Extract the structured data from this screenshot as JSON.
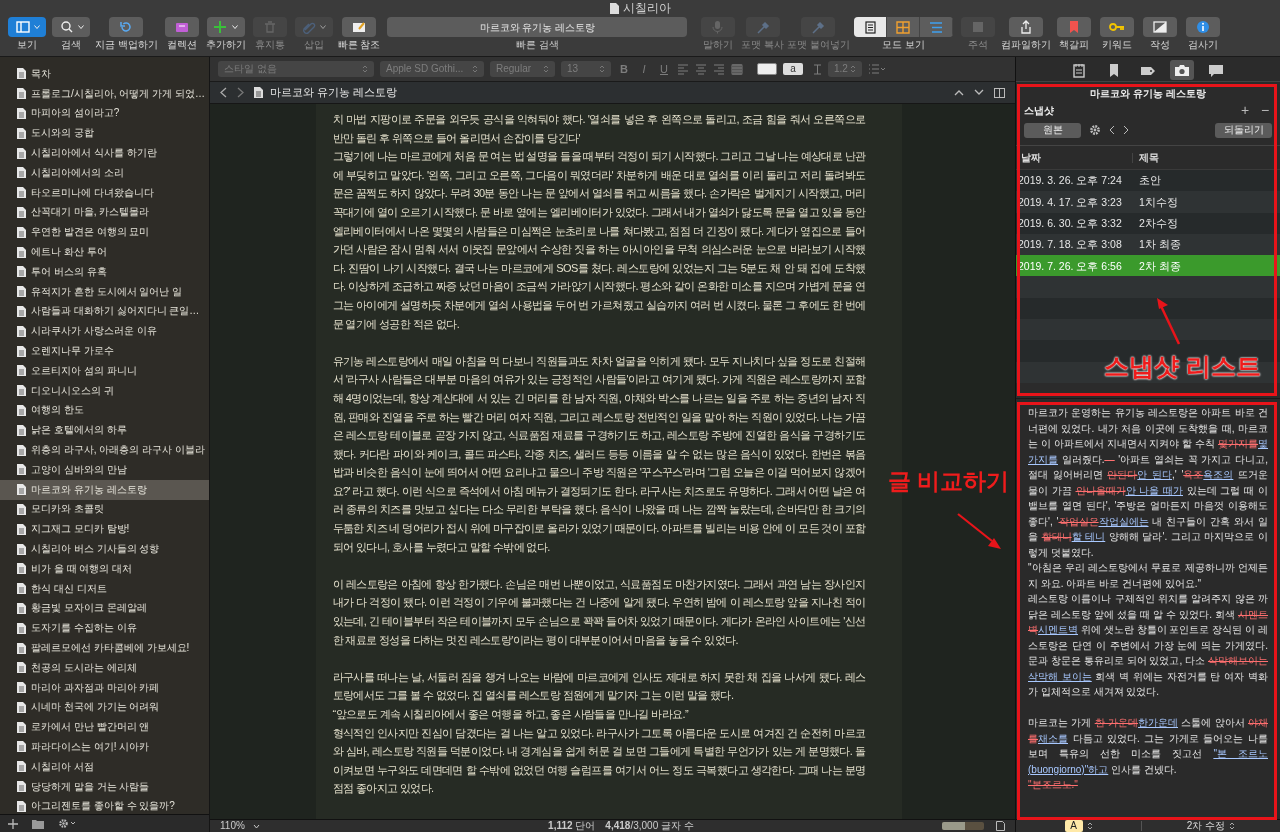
{
  "window": {
    "title": "시칠리아"
  },
  "toolbar": {
    "left": [
      {
        "kind": "view",
        "label": "보기",
        "disabled": false
      },
      {
        "kind": "search",
        "label": "검색",
        "disabled": false
      },
      {
        "kind": "backup",
        "label": "지금 백업하기",
        "disabled": false
      },
      {
        "kind": "collection",
        "label": "컬렉션",
        "disabled": false
      },
      {
        "kind": "add",
        "label": "추가하기",
        "disabled": false
      },
      {
        "kind": "trash",
        "label": "휴지통",
        "disabled": true
      },
      {
        "kind": "insert",
        "label": "삽입",
        "disabled": true
      },
      {
        "kind": "quickref",
        "label": "빠른 참조",
        "disabled": false
      }
    ],
    "quick_search": {
      "value": "마르코와 유기농 레스토랑",
      "label": "빠른 검색"
    },
    "right": [
      {
        "kind": "speak",
        "label": "말하기",
        "disabled": true
      },
      {
        "kind": "copyformat",
        "label": "포맷 복사",
        "disabled": true
      },
      {
        "kind": "pasteformat",
        "label": "포맷 붙여넣기",
        "disabled": true
      },
      {
        "kind": "mode",
        "label": "모드 보기",
        "disabled": false,
        "segments": [
          {
            "kind": "text",
            "selected": true
          },
          {
            "kind": "grid",
            "selected": false
          },
          {
            "kind": "outline",
            "selected": false
          }
        ]
      },
      {
        "kind": "comment",
        "label": "주석",
        "disabled": true
      },
      {
        "kind": "compile",
        "label": "컴파일하기",
        "disabled": false
      },
      {
        "kind": "bookmark",
        "label": "책갈피",
        "disabled": false
      },
      {
        "kind": "keyword",
        "label": "키워드",
        "disabled": false
      },
      {
        "kind": "compose",
        "label": "작성",
        "disabled": false
      },
      {
        "kind": "inspector",
        "label": "검사기",
        "disabled": false
      }
    ]
  },
  "format_bar": {
    "style": "스타일 없음",
    "font": "Apple SD Gothi...",
    "weight": "Regular",
    "size": "13",
    "buttons": [
      "B",
      "I",
      "U"
    ],
    "highlight_label": "a",
    "line_spacing": "1.2"
  },
  "binder": {
    "items": [
      {
        "label": "목차",
        "selected": false
      },
      {
        "label": "프롤로그/시칠리아, 어떻게 가게 되었…",
        "selected": false
      },
      {
        "label": "마피아의 섬이라고?",
        "selected": false
      },
      {
        "label": "도시와의 궁합",
        "selected": false
      },
      {
        "label": "시칠리아에서 식사를 하기란",
        "selected": false
      },
      {
        "label": "시칠리아에서의 소리",
        "selected": false
      },
      {
        "label": "타오르미나에 다녀왔습니다",
        "selected": false
      },
      {
        "label": "산꼭대기 마을, 카스텔몰라",
        "selected": false
      },
      {
        "label": "우연한 발견은 여행의 묘미",
        "selected": false
      },
      {
        "label": "에트나 화산 투어",
        "selected": false
      },
      {
        "label": "투어 버스의 유혹",
        "selected": false
      },
      {
        "label": "유적지가 흔한 도시에서 일어난 일",
        "selected": false
      },
      {
        "label": "사람들과 대화하기 싫어지다니 큰일…",
        "selected": false
      },
      {
        "label": "시라쿠사가 사랑스러운 이유",
        "selected": false
      },
      {
        "label": "오렌지나무 가로수",
        "selected": false
      },
      {
        "label": "오르티지아 섬의 파니니",
        "selected": false
      },
      {
        "label": "디오니시오스의 귀",
        "selected": false
      },
      {
        "label": "여행의 한도",
        "selected": false
      },
      {
        "label": "낡은 호텔에서의 하루",
        "selected": false
      },
      {
        "label": "위층의 라구사, 아래층의 라구사 이블라",
        "selected": false
      },
      {
        "label": "고양이 심바와의 만남",
        "selected": false
      },
      {
        "label": "마르코와 유기농 레스토랑",
        "selected": true
      },
      {
        "label": "모디카와 초콜릿",
        "selected": false
      },
      {
        "label": "지그재그 모디카 탐방!",
        "selected": false
      },
      {
        "label": "시칠리아 버스 기사들의 성향",
        "selected": false
      },
      {
        "label": "비가 올 때 여행의 대처",
        "selected": false
      },
      {
        "label": "한식 대신 디저트",
        "selected": false
      },
      {
        "label": "황금빛 모자이크 몬레알레",
        "selected": false
      },
      {
        "label": "도자기를 수집하는 이유",
        "selected": false
      },
      {
        "label": "팔레르모에선 카타콤베에 가보세요!",
        "selected": false
      },
      {
        "label": "천공의 도시라는 에리체",
        "selected": false
      },
      {
        "label": "마리아 과자점과 마리아 카페",
        "selected": false
      },
      {
        "label": "시네마 천국에 가기는 어려워",
        "selected": false
      },
      {
        "label": "로카에서 만난 빨간머리 앤",
        "selected": false
      },
      {
        "label": "파라다이스는 여기! 시아카",
        "selected": false
      },
      {
        "label": "시칠리아 서점",
        "selected": false
      },
      {
        "label": "당당하게 말을 거는 사람들",
        "selected": false
      },
      {
        "label": "아그리젠토를 좋아할 수 있을까?",
        "selected": false
      }
    ]
  },
  "editor": {
    "title": "마르코와 유기농 레스토랑",
    "paragraphs": [
      {
        "spaced": false,
        "text": "치 마법 지팡이로 주문을 외우듯 공식을 익혀둬야 했다. '열쇠를 넣은 후  왼쪽으로 돌리고, 조금 힘을 줘서 오른쪽으로 반만 돌린 후 위쪽으로 들어 올리면서 손잡이를 당긴다'"
      },
      {
        "spaced": false,
        "text": "그렇기에 나는 마르코에게 처음 문 여는 법 설명을 들을 때부터 걱정이 되기 시작했다. 그리고 그날 나는 예상대로 난관에 부딪히고 말았다. '왼쪽, 그리고 오른쪽, 그다음이 뭐였더라' 차분하게 배운 대로 열쇠를 이리 돌리고 저리 돌려봐도 문은 꿈쩍도 하지 않았다. 무려 30분 동안 나는 문 앞에서 열쇠를 쥐고 씨름을 했다. 손가락은 벌게지기 시작했고, 머리 꼭대기에 열이 오르기 시작했다. 문 바로 옆에는 엘리베이터가 있었다. 그래서 내가 열쇠가 닳도록 문을 열고 있을 동안 엘리베이터에서 나온 몇몇의 사람들은 미심쩍은 눈초리로 나를 쳐다봤고, 점점 더 긴장이 됐다. 게다가 옆집으로 들어가던 사람은 잠시 멈춰 서서 이웃집 문앞에서 수상한 짓을 하는 아시아인을 무척 의심스러운 눈으로 바라보기 시작했다. 진땀이 나기 시작했다. 결국 나는 마르코에게 SOS를 쳤다. 레스토랑에 있었는지 그는 5분도 채 안 돼 집에 도착했다. 이상하게 조급하고 짜증 났던 마음이 조금씩 가라앉기 시작했다. 평소와 같이 온화한 미소를 지으며 가볍게 문을 연 그는 아이에게 설명하듯 차분에게 열쇠 사용법을 두어 번 가르쳐줬고 실습까지 여러 번 시켰다. 물론 그 후에도 한 번에 문 열기에 성공한 적은 없다."
      },
      {
        "spaced": true,
        "text": "유기농 레스토랑에서 매일 아침을 먹 다보니 직원들과도 차차 얼굴을 익히게 됐다. 모두 지나치다 싶을 정도로 친절해서 '라구사 사람들은 대부분 마음의 여유가 있는 긍정적인 사람들'이라고 여기게 됐다. 가게 직원은 레스토랑까지 포함해 4명이었는데, 항상 계산대에 서 있는 긴 머리를 한 남자 직원, 야채와 박스를 나르는 일을 주로 하는 중년의 남자 직원, 판매와 진열을 주로 하는 빨간 머리 여자 직원, 그리고 레스토랑 전반적인 일을 맡아 하는 직원이 있었다. 나는 가끔은 레스토랑 테이블로 곧장 가지 않고, 식료품점 재료를 구경하기도 하고, 레스토랑 주방에 진열한 음식을 구경하기도 했다. 커다란 파이와 케이크, 콜드 파스타, 각종 치즈, 샐러드 등등 이름을 알 수 없는 많은 음식이 있었다. 한번은 볶음밥과 비슷한 음식이 눈에 띄어서 어떤 요리냐고 물으니 주방 직원은 '꾸스꾸스'라며 '그럼 오늘은 이걸 먹어보지 않겠어요?' 라고 했다. 이런 식으로 즉석에서 아침 메뉴가 결정되기도 한다. 라구사는 치즈로도 유명하다. 그래서 어떤 날은 여러 종류의 치즈를 맛보고 싶다는 다소 무리한 부탁을 했다. 음식이 나왔을 때 나는 깜짝 놀랐는데, 손바닥만 한 크기의 두툼한 치즈 네 덩어리가 접시 위에 마구잡이로 올라가 있었기 때문이다. 아파트를 빌리는 비용 안에 이 모든 것이 포함되어 있다니, 호사를 누렸다고 말할 수밖에 없다."
      },
      {
        "spaced": true,
        "text": "이 레스토랑은 아침에 항상 한가했다. 손님은 매번 나뿐이었고, 식료품점도 마찬가지였다. 그래서 과연 남는 장사인지 내가 다 걱정이 됐다. 이런 걱정이 기우에 불과했다는 건 나중에 알게 됐다. 우연히 밤에 이 레스토랑 앞을 지나친 적이 있는데, 긴 테이블부터 작은 테이블까지 모두 손님으로 꽉꽉 들어차 있었기 때문이다. 게다가 온라인 사이트에는 '신선한 재료로 정성을 다하는 멋진 레스토랑'이라는 평이 대부분이어서 마음을 놓을 수 있었다."
      },
      {
        "spaced": true,
        "text": "라구사를 떠나는 날, 서둘러 짐을 챙겨 나오는 바람에 마르코에게 인사도 제대로 하지 못한 채 집을 나서게 됐다. 레스토랑에서도 그를 볼 수 없었다. 집 열쇠를 레스토랑 점원에게 맡기자 그는 이런 말을 했다."
      },
      {
        "spaced": false,
        "text": "“앞으로도 계속 시칠리아에서 좋은 여행을 하고, 좋은 사람들을 만나길 바라요.”"
      },
      {
        "spaced": false,
        "text": "형식적인 인사지만 진심이 담겼다는 걸 나는 알고 있었다. 라구사가 그토록 아름다운 도시로 여겨진 건 순전히 마르코와 심바, 레스토랑 직원들 덕분이었다. 내 경계심을 쉽게 허문 걸 보면 그들에게 특별한 무언가가 있는 게 분명했다. 돌이켜보면 누구와도 데면데면 할 수밖에 없었던 여행 슬럼프를 여기서 어느 정도 극복했다고 생각한다. 그때 나는 분명 점점 좋아지고 있었다."
      }
    ]
  },
  "status_bar": {
    "zoom": "110%",
    "words": "**1,112** 단어",
    "characters": "**4,418**/3,000 글자 수",
    "target": {
      "level": 0.55
    }
  },
  "inspector": {
    "tabs": [
      {
        "kind": "notes",
        "selected": false
      },
      {
        "kind": "bookmark",
        "selected": false
      },
      {
        "kind": "tag",
        "selected": false
      },
      {
        "kind": "snapshot",
        "selected": true
      },
      {
        "kind": "comment",
        "selected": false
      }
    ],
    "title": "마르코와 유기농 레스토랑",
    "section": "스냅샷",
    "add_button": "+",
    "remove_button": "−",
    "original_button": "원본",
    "revert_button": "되돌리기",
    "snapshots": {
      "columns": [
        "날짜",
        "제목"
      ],
      "rows": [
        {
          "date": "2019. 3. 26. 오후 7:24",
          "title": "초안",
          "selected": false
        },
        {
          "date": "2019. 4. 17. 오후 3:23",
          "title": "1치수정",
          "selected": false
        },
        {
          "date": "2019. 6. 30. 오후 3:32",
          "title": "2차수정",
          "selected": false
        },
        {
          "date": "2019. 7. 18. 오후 3:08",
          "title": "1차 최종",
          "selected": false
        },
        {
          "date": "2019. 7. 26. 오후 6:56",
          "title": "2차 최종",
          "selected": true
        }
      ]
    },
    "comparison": [
      {
        "spaced": false,
        "segments": [
          {
            "kind": "plain",
            "text": "마르코가 운영하는 유기농 레스토랑은 아파트 바로 건너편에 있었다. 내가 처음 이곳에 도착했을 때, 마르코는 이 아파트에서 지내면서 지켜야 할 수칙 "
          },
          {
            "kind": "deleted",
            "text": "몇가지를"
          },
          {
            "kind": "inserted",
            "text": "몇 가지를"
          },
          {
            "kind": "plain",
            "text": " 일러줬다."
          },
          {
            "kind": "deleted",
            "text": "—"
          },
          {
            "kind": "plain",
            "text": " '아파트 열쇠는 꼭 가지고 다니고, 절대 잃어버리면 "
          },
          {
            "kind": "deleted",
            "text": "안된다"
          },
          {
            "kind": "inserted",
            "text": "안 된다"
          },
          {
            "kind": "plain",
            "text": ",' '"
          },
          {
            "kind": "deleted",
            "text": "욕조"
          },
          {
            "kind": "inserted",
            "text": "욕조의"
          },
          {
            "kind": "plain",
            "text": " 뜨거운 물이 가끔 "
          },
          {
            "kind": "deleted",
            "text": "안나올때가"
          },
          {
            "kind": "inserted",
            "text": "안 나올 때가"
          },
          {
            "kind": "plain",
            "text": " 있는데 그럴 때 이 밸브를 열면 된다', '주방은 얼마든지 마음껏 이용해도 좋다', '"
          },
          {
            "kind": "deleted",
            "text": "작업실은"
          },
          {
            "kind": "inserted",
            "text": "작업실에는"
          },
          {
            "kind": "plain",
            "text": " 내 친구들이 간혹 와서 일을 "
          },
          {
            "kind": "deleted",
            "text": "할테니"
          },
          {
            "kind": "inserted",
            "text": "할 테니"
          },
          {
            "kind": "plain",
            "text": " 양해해 달라'. 그리고 마지막으로 이렇게 덧붙였다."
          }
        ]
      },
      {
        "spaced": false,
        "segments": [
          {
            "kind": "plain",
            "text": "\"아침은 우리 레스토랑에서 무료로 제공하니까 언제든지 와요. 아파트 바로 건너편에 있어요.\""
          }
        ]
      },
      {
        "spaced": false,
        "segments": [
          {
            "kind": "plain",
            "text": "레스토랑 이름이나 구체적인 위치를 알려주지 않은 까닭은 레스토랑 앞에 섰을 때 알 수 있었다. 회색 "
          },
          {
            "kind": "deleted",
            "text": "시멘트 벽"
          },
          {
            "kind": "inserted",
            "text": "시멘트벽"
          },
          {
            "kind": "plain",
            "text": " 위에 샛노란 창틀이 포인트로 장식된 이 레스토랑은 단연 이 주변에서 가장 눈에 띄는 가게였다. 문과 창문은 통유리로 되어 있었고, 다소 "
          },
          {
            "kind": "deleted",
            "text": "삭막해보이는"
          },
          {
            "kind": "inserted",
            "text": "삭막해 보이는"
          },
          {
            "kind": "plain",
            "text": " 회색 벽 위에는 자전거를 탄 여자 벽화가 입체적으로 새겨져 있었다."
          }
        ]
      },
      {
        "spaced": true,
        "segments": [
          {
            "kind": "plain",
            "text": "마르코는 가게 "
          },
          {
            "kind": "deleted",
            "text": "한 가운데"
          },
          {
            "kind": "inserted",
            "text": "한가운데"
          },
          {
            "kind": "plain",
            "text": " 스툴에 앉아서 "
          },
          {
            "kind": "deleted",
            "text": "야채를"
          },
          {
            "kind": "inserted",
            "text": "채소를"
          },
          {
            "kind": "plain",
            "text": " 다듬고 있었다. 그는 가게로 들어오는 나를 보며 특유의 선한 미소를 짓고선 "
          },
          {
            "kind": "inserted",
            "text": "\"본 조르노(buongiorno)\"하고"
          },
          {
            "kind": "plain",
            "text": " 인사를 건넸다."
          }
        ]
      },
      {
        "spaced": false,
        "segments": [
          {
            "kind": "deleted",
            "text": "\"본조르노.\""
          }
        ]
      }
    ],
    "footer": {
      "font_button": "A",
      "compare_menu": "2차 수정"
    }
  },
  "annotations": [
    {
      "text": "스냅샷 리스트"
    },
    {
      "text": "글 비교하기"
    }
  ]
}
